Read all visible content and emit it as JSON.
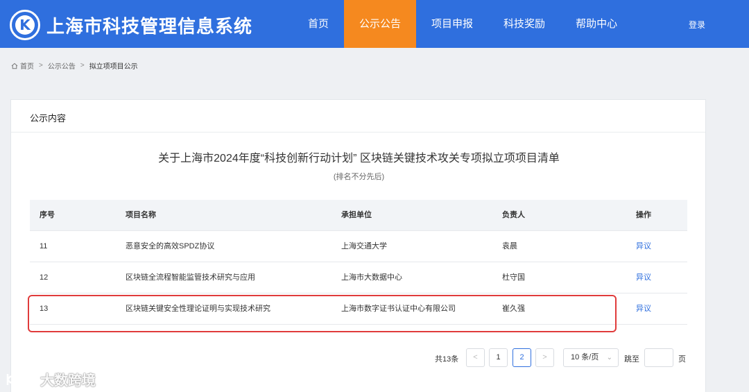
{
  "header": {
    "logo_letter": "K",
    "site_title": "上海市科技管理信息系统",
    "nav": [
      {
        "label": "首页",
        "active": false
      },
      {
        "label": "公示公告",
        "active": true
      },
      {
        "label": "项目申报",
        "active": false
      },
      {
        "label": "科技奖励",
        "active": false
      },
      {
        "label": "帮助中心",
        "active": false
      }
    ],
    "login": "登录",
    "colors": {
      "bar": "#2f6fde",
      "active": "#f5891f"
    }
  },
  "breadcrumb": {
    "items": [
      "首页",
      "公示公告",
      "拟立项项目公示"
    ],
    "separator": ">"
  },
  "card": {
    "title": "公示内容",
    "list_title": "关于上海市2024年度“科技创新行动计划” 区块链关键技术攻关专项拟立项项目清单",
    "list_subtitle": "(排名不分先后)"
  },
  "table": {
    "headers": [
      "序号",
      "项目名称",
      "承担单位",
      "负责人",
      "操作"
    ],
    "rows": [
      {
        "no": "11",
        "name": "恶意安全的高效SPDZ协议",
        "org": "上海交通大学",
        "leader": "袁晨",
        "action": "异议"
      },
      {
        "no": "12",
        "name": "区块链全流程智能监管技术研究与应用",
        "org": "上海市大数据中心",
        "leader": "杜守国",
        "action": "异议"
      },
      {
        "no": "13",
        "name": "区块链关键安全性理论证明与实现技术研究",
        "org": "上海市数字证书认证中心有限公司",
        "leader": "崔久强",
        "action": "异议"
      }
    ]
  },
  "pagination": {
    "total": "共13条",
    "prev": "<",
    "pages": [
      "1",
      "2"
    ],
    "current_page": "2",
    "next": ">",
    "page_size": "10 条/页",
    "jump_label": "跳至",
    "jump_value": "",
    "page_suffix": "页"
  },
  "watermark": {
    "text": "大数跨境"
  }
}
